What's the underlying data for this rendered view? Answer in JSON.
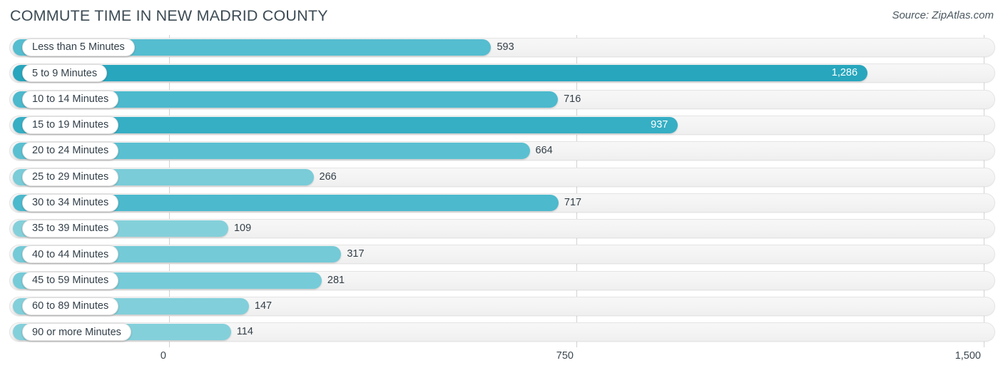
{
  "header": {
    "title": "COMMUTE TIME IN NEW MADRID COUNTY",
    "source": "Source: ZipAtlas.com"
  },
  "chart_data": {
    "type": "bar",
    "orientation": "horizontal",
    "title": "COMMUTE TIME IN NEW MADRID COUNTY",
    "xlabel": "",
    "ylabel": "",
    "xlim": [
      0,
      1500
    ],
    "grid": true,
    "legend": "none",
    "xticks": [
      "0",
      "750",
      "1,500"
    ],
    "xtick_values": [
      0,
      750,
      1500
    ],
    "categories": [
      "Less than 5 Minutes",
      "5 to 9 Minutes",
      "10 to 14 Minutes",
      "15 to 19 Minutes",
      "20 to 24 Minutes",
      "25 to 29 Minutes",
      "30 to 34 Minutes",
      "35 to 39 Minutes",
      "40 to 44 Minutes",
      "45 to 59 Minutes",
      "60 to 89 Minutes",
      "90 or more Minutes"
    ],
    "values": [
      593,
      1286,
      716,
      937,
      664,
      266,
      717,
      109,
      317,
      281,
      147,
      114
    ],
    "value_labels": [
      "593",
      "1,286",
      "716",
      "937",
      "664",
      "266",
      "717",
      "109",
      "317",
      "281",
      "147",
      "114"
    ],
    "bar_colors": [
      "#55bdd0",
      "#27a6bd",
      "#4cb9cd",
      "#36aec4",
      "#5ac0d1",
      "#79ccd8",
      "#4cb9cd",
      "#84d0da",
      "#74cad7",
      "#76cbd8",
      "#81cfda",
      "#83d0db"
    ],
    "value_label_inside": [
      false,
      true,
      false,
      true,
      false,
      false,
      false,
      false,
      false,
      false,
      false,
      false
    ],
    "track_color": "#f4f4f4",
    "gridline_color": "#d2d2d2"
  }
}
